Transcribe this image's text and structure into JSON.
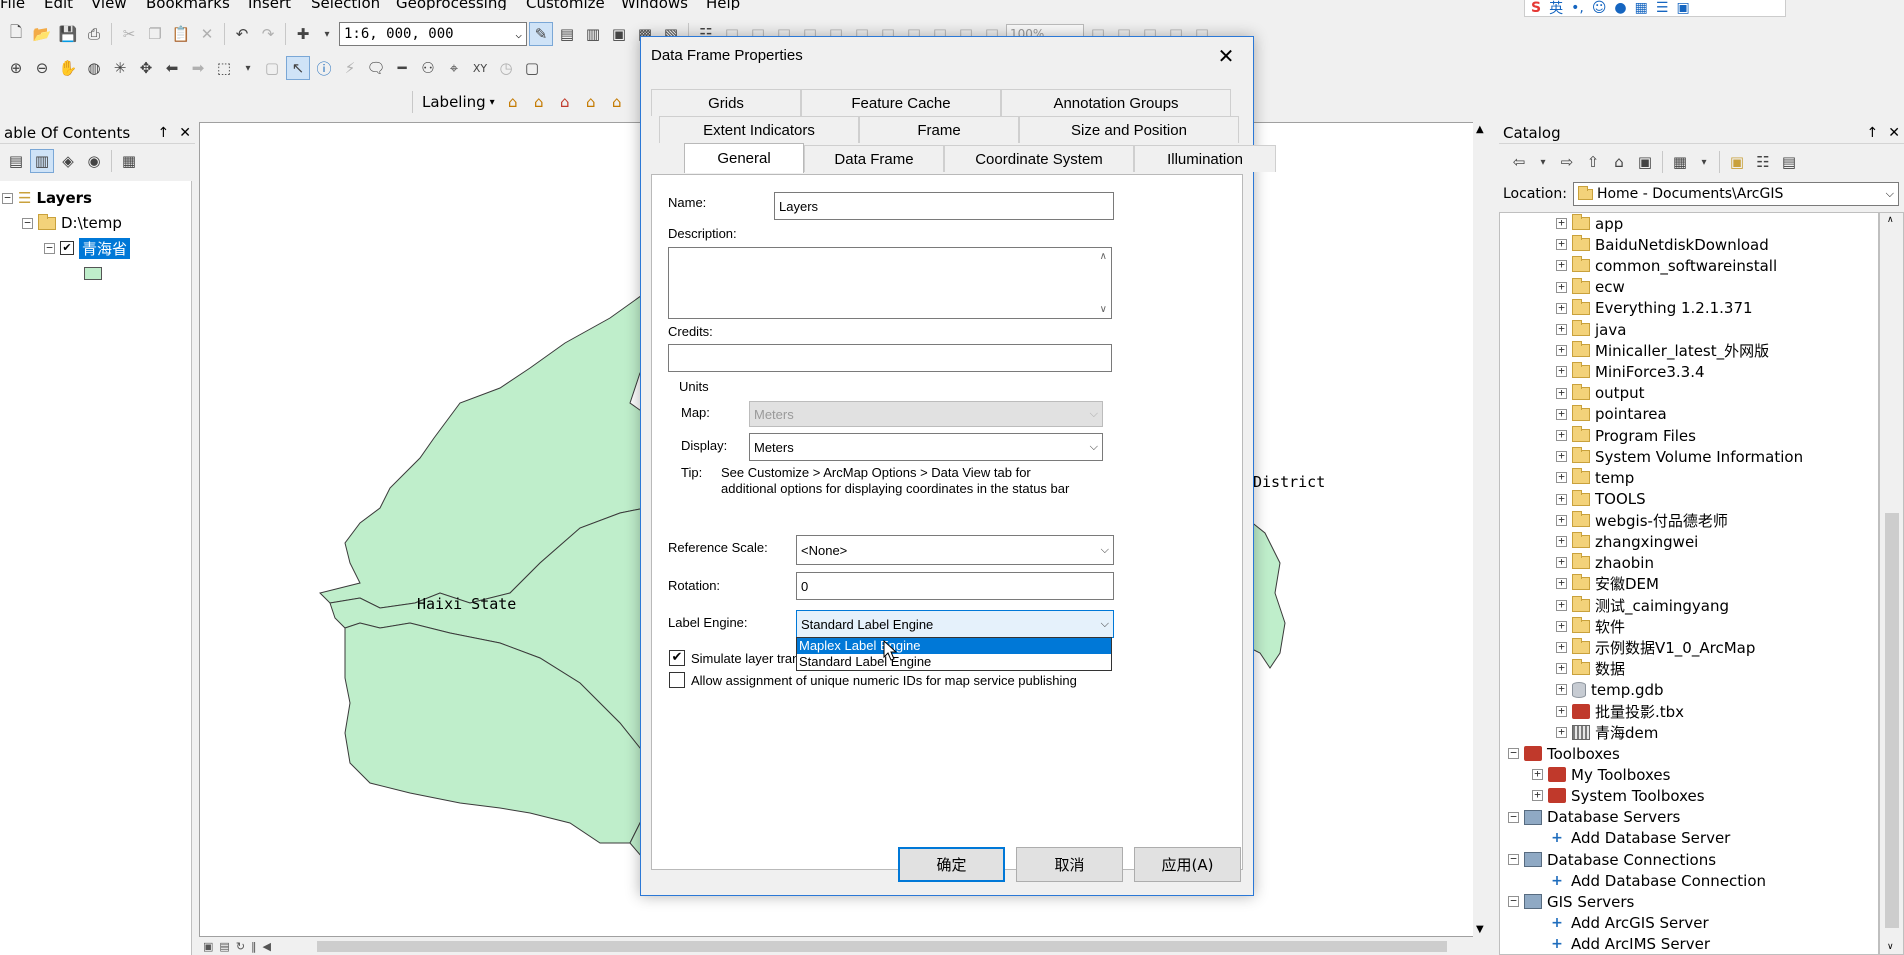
{
  "menu": [
    "File",
    "Edit",
    "View",
    "Bookmarks",
    "Insert",
    "Selection",
    "Geoprocessing",
    "Customize",
    "Windows",
    "Help"
  ],
  "ime": {
    "logo": "S",
    "mode": "英"
  },
  "toolbar": {
    "scale": "1:6, 000, 000",
    "zoom": "100%",
    "labeling": "Labeling"
  },
  "toc": {
    "title": "able Of Contents",
    "pin": "↑",
    "close": "✕",
    "tree": {
      "root": "Layers",
      "folder": "D:\\temp",
      "layer": "青海省"
    }
  },
  "map": {
    "fill": "#bfeecb",
    "stroke": "#3a3a3a",
    "labels": {
      "haixi": "Haixi State",
      "district": "District"
    }
  },
  "catalog": {
    "title": "Catalog",
    "pin": "↑",
    "close": "✕",
    "location_label": "Location:",
    "location_value": "Home - Documents\\ArcGIS",
    "items": [
      {
        "label": "app",
        "icon": "folder",
        "level": 2
      },
      {
        "label": "BaiduNetdiskDownload",
        "icon": "folder",
        "level": 2
      },
      {
        "label": "common_softwareinstall",
        "icon": "folder",
        "level": 2
      },
      {
        "label": "ecw",
        "icon": "folder",
        "level": 2
      },
      {
        "label": "Everything 1.2.1.371",
        "icon": "folder",
        "level": 2
      },
      {
        "label": "java",
        "icon": "folder",
        "level": 2
      },
      {
        "label": "Minicaller_latest_外网版",
        "icon": "folder",
        "level": 2
      },
      {
        "label": "MiniForce3.3.4",
        "icon": "folder",
        "level": 2
      },
      {
        "label": "output",
        "icon": "folder",
        "level": 2
      },
      {
        "label": "pointarea",
        "icon": "folder",
        "level": 2
      },
      {
        "label": "Program Files",
        "icon": "folder",
        "level": 2
      },
      {
        "label": "System Volume Information",
        "icon": "folder",
        "level": 2
      },
      {
        "label": "temp",
        "icon": "folder",
        "level": 2
      },
      {
        "label": "TOOLS",
        "icon": "folder",
        "level": 2
      },
      {
        "label": "webgis-付品德老师",
        "icon": "folder",
        "level": 2
      },
      {
        "label": "zhangxingwei",
        "icon": "folder",
        "level": 2
      },
      {
        "label": "zhaobin",
        "icon": "folder",
        "level": 2
      },
      {
        "label": "安徽DEM",
        "icon": "folder",
        "level": 2
      },
      {
        "label": "测试_caimingyang",
        "icon": "folder",
        "level": 2
      },
      {
        "label": "软件",
        "icon": "folder",
        "level": 2
      },
      {
        "label": "示例数据V1_0_ArcMap",
        "icon": "folder",
        "level": 2
      },
      {
        "label": "数据",
        "icon": "folder",
        "level": 2
      },
      {
        "label": "temp.gdb",
        "icon": "gdb",
        "level": 2
      },
      {
        "label": "批量投影.tbx",
        "icon": "tbx",
        "level": 2
      },
      {
        "label": "青海dem",
        "icon": "grid",
        "level": 2
      },
      {
        "label": "Toolboxes",
        "icon": "tbx",
        "level": 0,
        "expanded": true
      },
      {
        "label": "My Toolboxes",
        "icon": "tbx",
        "level": 1
      },
      {
        "label": "System Toolboxes",
        "icon": "tbx",
        "level": 1
      },
      {
        "label": "Database Servers",
        "icon": "srv",
        "level": 0,
        "expanded": true
      },
      {
        "label": "Add Database Server",
        "icon": "add",
        "level": 1,
        "leaf": true
      },
      {
        "label": "Database Connections",
        "icon": "srv",
        "level": 0,
        "expanded": true
      },
      {
        "label": "Add Database Connection",
        "icon": "add",
        "level": 1,
        "leaf": true
      },
      {
        "label": "GIS Servers",
        "icon": "srv",
        "level": 0,
        "expanded": true
      },
      {
        "label": "Add ArcGIS Server",
        "icon": "add",
        "level": 1,
        "leaf": true
      },
      {
        "label": "Add ArcIMS Server",
        "icon": "add",
        "level": 1,
        "leaf": true
      }
    ]
  },
  "dialog": {
    "title": "Data Frame Properties",
    "tabs_row1": [
      "Grids",
      "Feature Cache",
      "Annotation Groups"
    ],
    "tabs_row2": [
      "Extent Indicators",
      "Frame",
      "Size and Position"
    ],
    "tabs_row3": [
      "General",
      "Data Frame",
      "Coordinate System",
      "Illumination"
    ],
    "selected_tab": "General",
    "name_label": "Name:",
    "name_value": "Layers",
    "description_label": "Description:",
    "credits_label": "Credits:",
    "units_label": "Units",
    "map_label": "Map:",
    "map_value": "Meters",
    "display_label": "Display:",
    "display_value": "Meters",
    "tip_label": "Tip:",
    "tip_line1": "See Customize > ArcMap Options > Data View tab for",
    "tip_line2": "additional options for displaying coordinates in the status bar",
    "refscale_label": "Reference Scale:",
    "refscale_value": "<None>",
    "rotation_label": "Rotation:",
    "rotation_value": "0",
    "label_engine_label": "Label Engine:",
    "label_engine_value": "Standard Label Engine",
    "label_engine_options": [
      "Maplex Label Engine",
      "Standard Label Engine"
    ],
    "simulate_label": "Simulate layer tran",
    "simulate_checked": true,
    "allow_label": "Allow assignment of unique numeric IDs for map service publishing",
    "allow_checked": false,
    "ok": "确定",
    "cancel": "取消",
    "apply": "应用(A)",
    "close": "✕"
  }
}
